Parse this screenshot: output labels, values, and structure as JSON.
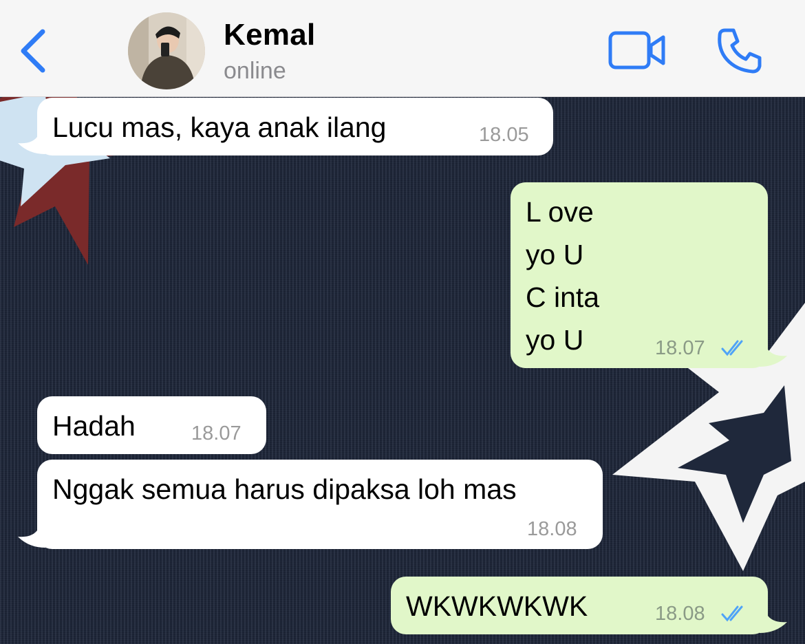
{
  "header": {
    "back_label": "",
    "contact_name": "Kemal",
    "status": "online",
    "icons": {
      "back": "chevron-left-icon",
      "video": "video-camera-icon",
      "call": "phone-icon"
    },
    "accent_color": "#2f7cf6"
  },
  "messages": [
    {
      "direction": "incoming",
      "text": "Lucu mas, kaya anak ilang",
      "time": "18.05"
    },
    {
      "direction": "outgoing",
      "text": "L ove\nyo U\nC inta\nyo U",
      "time": "18.07",
      "status": "read"
    },
    {
      "direction": "incoming",
      "text": "Hadah",
      "time": "18.07"
    },
    {
      "direction": "incoming",
      "text": "Nggak semua harus dipaksa loh mas",
      "time": "18.08"
    },
    {
      "direction": "outgoing",
      "text": "WKWKWKWK",
      "time": "18.08",
      "status": "read"
    }
  ],
  "colors": {
    "incoming_bubble": "#ffffff",
    "outgoing_bubble": "#e1f7c9",
    "read_ticks": "#4fa3f7",
    "wallpaper": "#1f283b"
  }
}
